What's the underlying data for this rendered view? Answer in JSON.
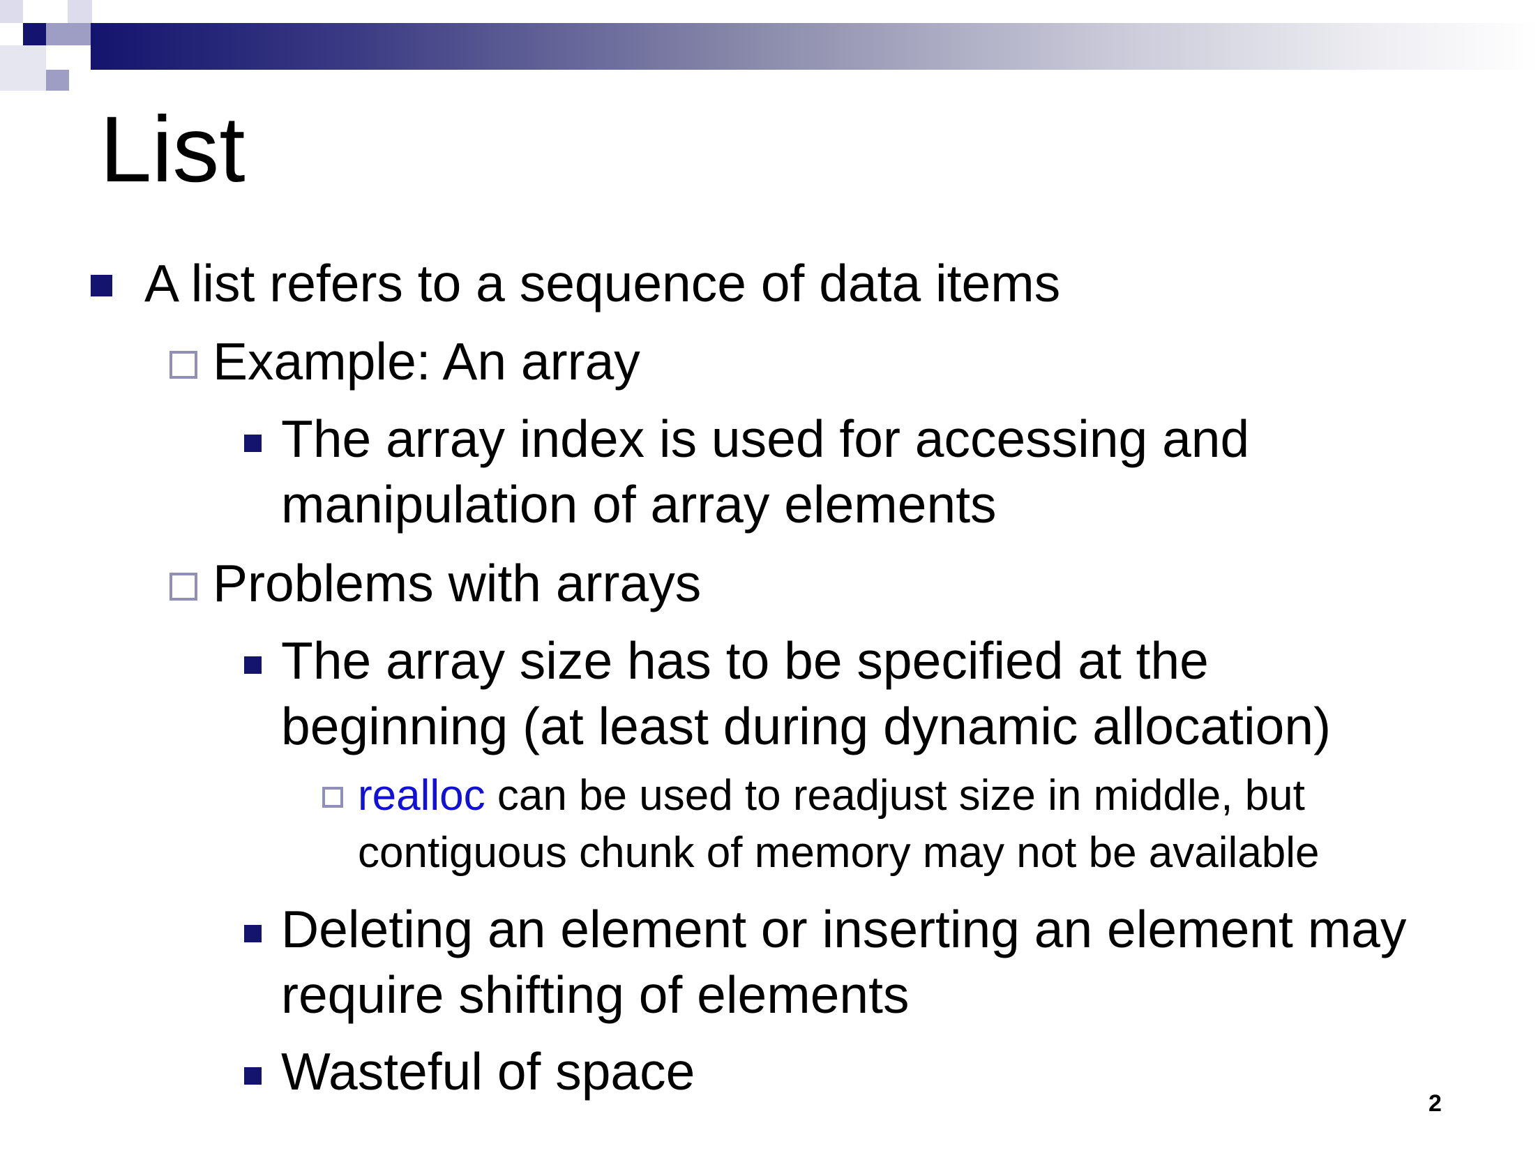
{
  "slide": {
    "title": "List",
    "page_number": "2",
    "accent_color": "#14146e",
    "highlight_color": "#1010d8"
  },
  "bullets": {
    "b1": {
      "text": "A list refers to a sequence of data items",
      "marker": "filled-square"
    },
    "b1_1": {
      "text": "Example: An array",
      "marker": "hollow-square"
    },
    "b1_1_1": {
      "line1": "The array index is used for accessing and",
      "line2": "manipulation of array elements",
      "marker": "filled-square"
    },
    "b1_2": {
      "text": "Problems with arrays",
      "marker": "hollow-square"
    },
    "b1_2_1": {
      "line1": "The array size has to be specified at the",
      "line2": "beginning (at least during dynamic allocation)",
      "marker": "filled-square"
    },
    "b1_2_1_1": {
      "highlight": "realloc",
      "line1_rest": " can be used to readjust size in middle, but",
      "line2": "contiguous chunk of memory may not be available",
      "marker": "hollow-square"
    },
    "b1_2_2": {
      "line1": "Deleting an element or inserting an element may",
      "line2": "require shifting of elements",
      "marker": "filled-square"
    },
    "b1_2_3": {
      "text": "Wasteful of space",
      "marker": "filled-square"
    }
  }
}
